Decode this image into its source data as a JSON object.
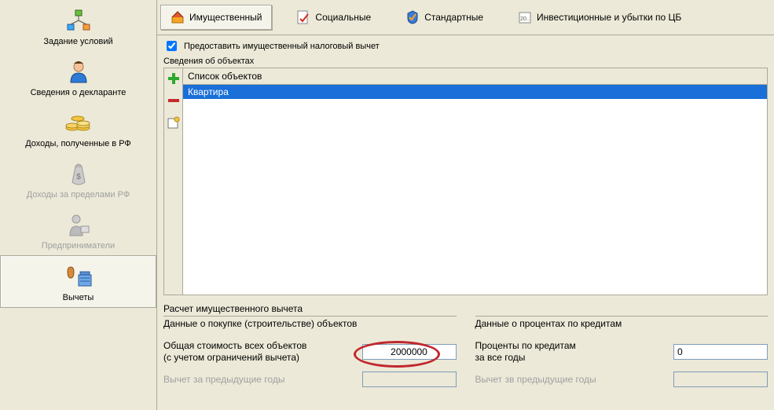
{
  "sidebar": {
    "items": [
      {
        "label": "Задание условий"
      },
      {
        "label": "Сведения о декларанте"
      },
      {
        "label": "Доходы, полученные в РФ"
      },
      {
        "label": "Доходы за пределами РФ"
      },
      {
        "label": "Предприниматели"
      },
      {
        "label": "Вычеты"
      }
    ]
  },
  "tabs": {
    "property": "Имущественный",
    "social": "Социальные",
    "standard": "Стандартные",
    "investment": "Инвестиционные и убытки по ЦБ"
  },
  "checkbox": {
    "label": "Предоставить имущественный налоговый вычет"
  },
  "objects": {
    "group_label": "Сведения об объектах",
    "header": "Список объектов",
    "rows": [
      "Квартира"
    ]
  },
  "calc": {
    "title": "Расчет имущественного вычета",
    "left": {
      "title": "Данные о покупке (строительстве) объектов",
      "total_label_line1": "Общая стоимость всех объектов",
      "total_label_line2": "(с учетом ограничений вычета)",
      "total_value": "2000000",
      "prev_label": "Вычет за предыдущие годы",
      "prev_value": ""
    },
    "right": {
      "title": "Данные о процентах по кредитам",
      "interest_label_line1": "Проценты по кредитам",
      "interest_label_line2": "за все годы",
      "interest_value": "0",
      "prev_label": "Вычет зв предыдущие годы",
      "prev_value": ""
    }
  }
}
